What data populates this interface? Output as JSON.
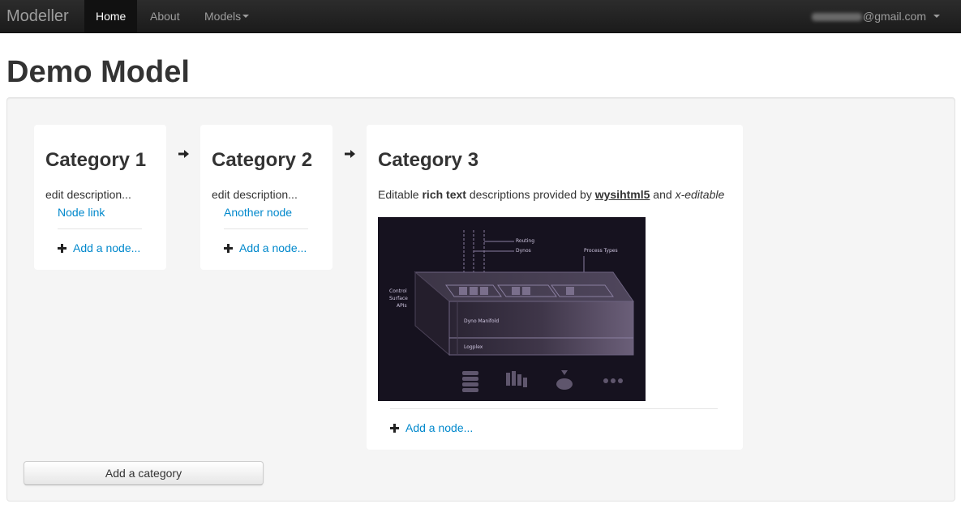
{
  "navbar": {
    "brand": "Modeller",
    "items": [
      {
        "label": "Home"
      },
      {
        "label": "About"
      },
      {
        "label": "Models"
      }
    ],
    "user_email_suffix": "@gmail.com"
  },
  "page": {
    "title": "Demo Model"
  },
  "categories": [
    {
      "title": "Category 1",
      "description": "edit description...",
      "nodes": [
        "Node link"
      ],
      "add_node_label": "Add a node..."
    },
    {
      "title": "Category 2",
      "description": "edit description...",
      "nodes": [
        "Another node"
      ],
      "add_node_label": "Add a node..."
    },
    {
      "title": "Category 3",
      "description_parts": {
        "p1": "Editable ",
        "b1": "rich text",
        "p2": " descriptions provided by ",
        "link": "wysihtml5",
        "p3": " and ",
        "i1": "x-editable"
      },
      "image": {
        "labels": {
          "routing": "Routing",
          "dynos": "Dynos",
          "process_types": "Process Types",
          "control_surface_1": "Control",
          "control_surface_2": "Surface",
          "control_surface_3": "APIs",
          "dyno_manifold": "Dyno Manifold",
          "logplex": "Logplex"
        }
      },
      "add_node_label": "Add a node..."
    }
  ],
  "actions": {
    "add_category_label": "Add a category"
  },
  "colors": {
    "link": "#0088cc",
    "navbar": "#1b1b1b",
    "well": "#f5f5f5"
  }
}
